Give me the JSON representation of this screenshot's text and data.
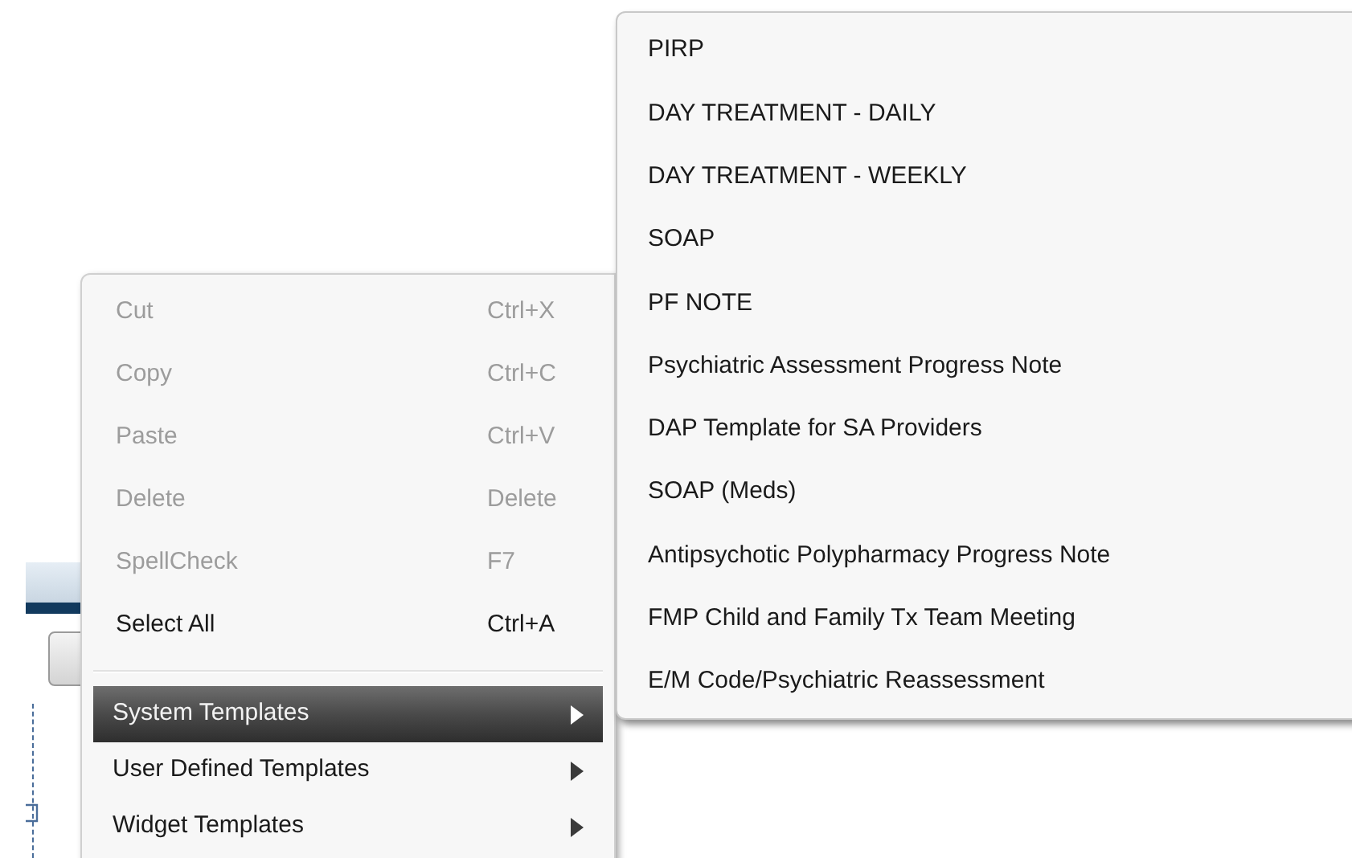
{
  "context_menu": {
    "items": [
      {
        "kind": "command",
        "label": "Cut",
        "shortcut": "Ctrl+X",
        "disabled": true,
        "selected": false
      },
      {
        "kind": "command",
        "label": "Copy",
        "shortcut": "Ctrl+C",
        "disabled": true,
        "selected": false
      },
      {
        "kind": "command",
        "label": "Paste",
        "shortcut": "Ctrl+V",
        "disabled": true,
        "selected": false
      },
      {
        "kind": "command",
        "label": "Delete",
        "shortcut": "Delete",
        "disabled": true,
        "selected": false
      },
      {
        "kind": "command",
        "label": "SpellCheck",
        "shortcut": "F7",
        "disabled": true,
        "selected": false
      },
      {
        "kind": "command",
        "label": "Select All",
        "shortcut": "Ctrl+A",
        "disabled": false,
        "selected": false
      },
      {
        "kind": "separator"
      },
      {
        "kind": "submenu",
        "label": "System Templates",
        "disabled": false,
        "selected": true
      },
      {
        "kind": "submenu",
        "label": "User Defined Templates",
        "disabled": false,
        "selected": false
      },
      {
        "kind": "submenu",
        "label": "Widget Templates",
        "disabled": false,
        "selected": false
      }
    ]
  },
  "submenu": {
    "items": [
      "PIRP",
      "DAY TREATMENT - DAILY",
      "DAY TREATMENT - WEEKLY",
      "SOAP",
      "PF NOTE",
      "Psychiatric Assessment Progress Note",
      "DAP Template for SA Providers",
      "SOAP (Meds)",
      "Antipsychotic Polypharmacy Progress Note",
      "FMP Child and Family Tx Team Meeting",
      "E/M Code/Psychiatric Reassessment"
    ]
  }
}
